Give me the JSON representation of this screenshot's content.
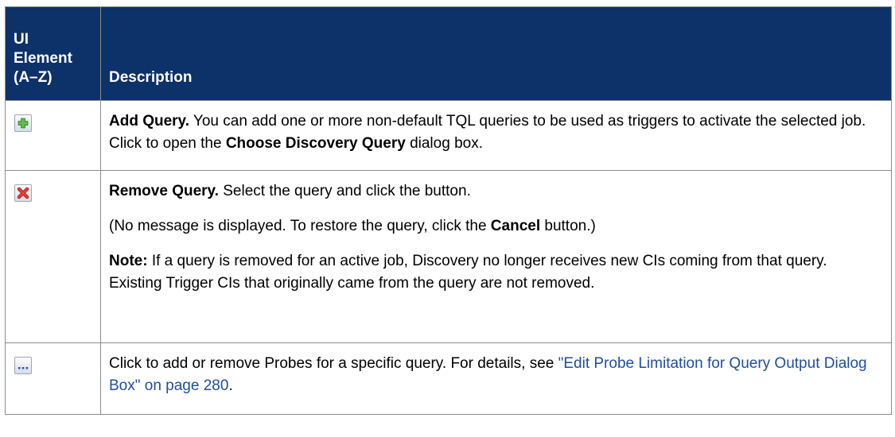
{
  "header": {
    "col1": [
      "UI",
      "Element",
      "(A–Z)"
    ],
    "col2": "Description"
  },
  "rows": [
    {
      "icon": "add-query-icon",
      "p1": {
        "term": "Add Query.",
        "a": " You can add one or more non-default TQL queries to be used as triggers to activate the selected job. Click to open the ",
        "b": "Choose Discovery Query",
        "c": " dialog box."
      }
    },
    {
      "icon": "remove-query-icon",
      "p1": {
        "term": "Remove Query.",
        "a": " Select the query and click the button."
      },
      "p2": {
        "a": "(No message is displayed. To restore the query, click the ",
        "b": "Cancel",
        "c": " button.)"
      },
      "p3": {
        "term": "Note:",
        "a": " If a query is removed for an active job, Discovery no longer receives new CIs coming from that query. Existing Trigger CIs that originally came from the query are not removed."
      }
    },
    {
      "icon": "ellipsis-icon",
      "p1": {
        "a": "Click to add or remove Probes for a specific query. For details, see ",
        "link": "\"Edit Probe Limitation for Query Output Dialog Box\" on page 280",
        "c": "."
      }
    }
  ],
  "colors": {
    "header_bg": "#0d3169",
    "header_text": "#ffffff",
    "link": "#1f4e9c"
  }
}
